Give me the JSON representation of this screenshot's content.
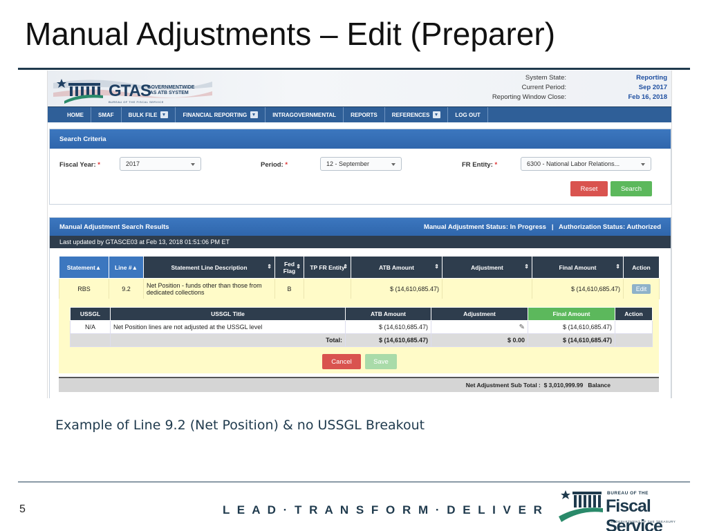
{
  "slide": {
    "title": "Manual Adjustments – Edit (Preparer)",
    "caption": "Example of Line 9.2 (Net Position) & no USSGL Breakout",
    "page_number": "5",
    "tagline": "L E A D · T R A N S F O R M · D E L I V E R",
    "logo": {
      "bureau": "BUREAU OF THE",
      "name": "Fiscal Service",
      "dept": "U.S. DEPARTMENT OF THE TREASURY"
    }
  },
  "app": {
    "logo_text": "GTAS",
    "logo_sub": "GOVERNMENTWIDE TAS ATB SYSTEM",
    "logo_bureau": "BUREAU OF THE FISCAL SERVICE",
    "system_state_label": "System State:",
    "system_state_value": "Reporting",
    "current_period_label": "Current Period:",
    "current_period_value": "Sep 2017",
    "window_close_label": "Reporting Window Close:",
    "window_close_value": "Feb 16, 2018"
  },
  "nav": {
    "home": "HOME",
    "smaf": "SMAF",
    "bulk_file": "BULK FILE",
    "financial_reporting": "FINANCIAL REPORTING",
    "intragovernmental": "INTRAGOVERNMENTAL",
    "reports": "REPORTS",
    "references": "REFERENCES",
    "logout": "LOG OUT"
  },
  "search": {
    "header": "Search Criteria",
    "fiscal_year_label": "Fiscal Year:",
    "fiscal_year_value": "2017",
    "period_label": "Period:",
    "period_value": "12 - September",
    "fr_entity_label": "FR Entity:",
    "fr_entity_value": "6300 - National Labor Relations...",
    "required_mark": "*",
    "reset_label": "Reset",
    "search_label": "Search"
  },
  "results": {
    "header": "Manual Adjustment Search Results",
    "status": "Manual Adjustment Status: In Progress   |   Authorization Status: Authorized",
    "last_updated": "Last updated by GTASCE03 at Feb 13, 2018 01:51:06 PM ET",
    "columns": {
      "statement": "Statement",
      "line": "Line #",
      "description": "Statement Line Description",
      "fed_flag": "Fed Flag",
      "tp_fr_entity": "TP FR Entity",
      "atb_amount": "ATB Amount",
      "adjustment": "Adjustment",
      "final_amount": "Final Amount",
      "action": "Action"
    },
    "row": {
      "statement": "RBS",
      "line": "9.2",
      "description": "Net Position - funds other than those from dedicated collections",
      "fed_flag": "B",
      "tp_fr_entity": "",
      "atb_amount": "$ (14,610,685.47)",
      "adjustment": "",
      "final_amount": "$ (14,610,685.47)",
      "action": "Edit"
    }
  },
  "ussgl": {
    "columns": {
      "ussgl": "USSGL",
      "title": "USSGL Title",
      "atb_amount": "ATB Amount",
      "adjustment": "Adjustment",
      "final_amount": "Final Amount",
      "action": "Action"
    },
    "row": {
      "ussgl": "N/A",
      "title": "Net Position lines are not adjusted at the USSGL level",
      "atb_amount": "$ (14,610,685.47)",
      "final_amount": "$ (14,610,685.47)"
    },
    "total": {
      "label": "Total:",
      "atb_amount": "$ (14,610,685.47)",
      "adjustment": "$ 0.00",
      "final_amount": "$ (14,610,685.47)"
    },
    "cancel_label": "Cancel",
    "save_label": "Save"
  },
  "summary": {
    "text": "Net Adjustment Sub Total :  $ 3,010,999.99   Balance"
  },
  "colors": {
    "nav_blue": "#2f5f98",
    "panel_blue": "#3c77bf",
    "dark_header": "#2e3d4d",
    "row_yellow": "#fffbc8",
    "reset_red": "#d9534f",
    "search_green": "#5cb85c",
    "save_green_disabled": "#a9dba9"
  },
  "icons": {
    "sort": "sort-icon",
    "dropdown": "chevron-down-icon",
    "pencil": "pencil-icon"
  }
}
